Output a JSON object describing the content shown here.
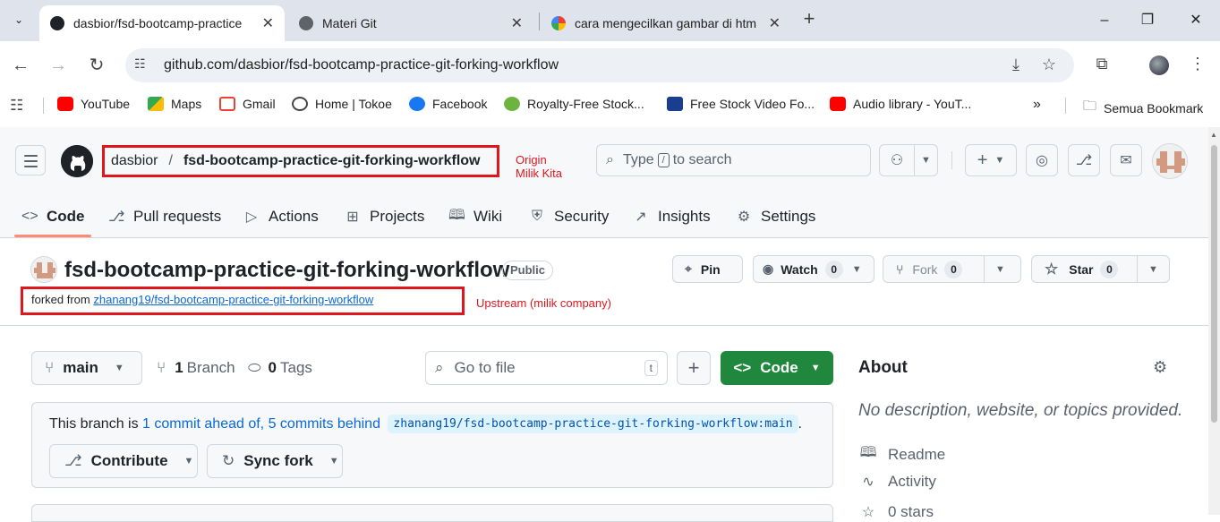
{
  "browser": {
    "tabs": [
      {
        "title": "dasbior/fsd-bootcamp-practice",
        "active": true
      },
      {
        "title": "Materi Git",
        "active": false
      },
      {
        "title": "cara mengecilkan gambar di htm",
        "active": false
      }
    ],
    "url": "github.com/dasbior/fsd-bootcamp-practice-git-forking-workflow",
    "bookmarks": [
      {
        "label": "YouTube",
        "icon": "youtube-icon",
        "color": "#ff0000"
      },
      {
        "label": "Maps",
        "icon": "maps-icon",
        "color": "#34a853"
      },
      {
        "label": "Gmail",
        "icon": "gmail-icon",
        "color": "#ea4335"
      },
      {
        "label": "Home | Tokoe",
        "icon": "globe-icon",
        "color": "#444444"
      },
      {
        "label": "Facebook",
        "icon": "facebook-icon",
        "color": "#1877f2"
      },
      {
        "label": "Royalty-Free Stock...",
        "icon": "leaf-icon",
        "color": "#6db33f"
      },
      {
        "label": "Free Stock Video Fo...",
        "icon": "videvo-icon",
        "color": "#1a3d8f"
      },
      {
        "label": "Audio library - YouT...",
        "icon": "youtube-icon",
        "color": "#ff0000"
      }
    ],
    "all_bookmarks": "Semua Bookmark",
    "more": "»"
  },
  "github": {
    "owner": "dasbior",
    "slash": "/",
    "repo": "fsd-bootcamp-practice-git-forking-workflow",
    "annotation_origin": [
      "Origin",
      "Milik Kita"
    ],
    "search_placeholder": [
      "Type",
      "/",
      "to search"
    ],
    "nav": [
      {
        "label": "Code",
        "icon": "code-icon",
        "active": true
      },
      {
        "label": "Pull requests",
        "icon": "pull-request-icon"
      },
      {
        "label": "Actions",
        "icon": "play-icon"
      },
      {
        "label": "Projects",
        "icon": "table-icon"
      },
      {
        "label": "Wiki",
        "icon": "book-icon"
      },
      {
        "label": "Security",
        "icon": "shield-icon"
      },
      {
        "label": "Insights",
        "icon": "graph-icon"
      },
      {
        "label": "Settings",
        "icon": "gear-icon"
      }
    ]
  },
  "repo": {
    "title": "fsd-bootcamp-practice-git-forking-workflow",
    "visibility": "Public",
    "forked_prefix": "forked from",
    "forked_link": "zhanang19/fsd-bootcamp-practice-git-forking-workflow",
    "annotation_upstream": "Upstream (milik company)",
    "pin": "Pin",
    "watch": "Watch",
    "watch_count": "0",
    "fork": "Fork",
    "fork_count": "0",
    "star": "Star",
    "star_count": "0"
  },
  "main": {
    "branch": "main",
    "branch_count": "1",
    "branch_label": "Branch",
    "tag_count": "0",
    "tag_label": "Tags",
    "go_to_file": "Go to file",
    "go_to_file_key": "t",
    "add": "+",
    "code_button": "Code",
    "status_prefix": "This branch is",
    "ahead": "1 commit ahead of,",
    "behind": "5 commits behind",
    "upstream_ref": "zhanang19/fsd-bootcamp-practice-git-forking-workflow:main",
    "status_suffix": ".",
    "contribute": "Contribute",
    "sync_fork": "Sync fork"
  },
  "about": {
    "title": "About",
    "description": "No description, website, or topics provided.",
    "items": [
      {
        "label": "Readme",
        "icon": "book-icon"
      },
      {
        "label": "Activity",
        "icon": "pulse-icon"
      },
      {
        "label": "0 stars",
        "icon": "star-icon"
      }
    ]
  }
}
